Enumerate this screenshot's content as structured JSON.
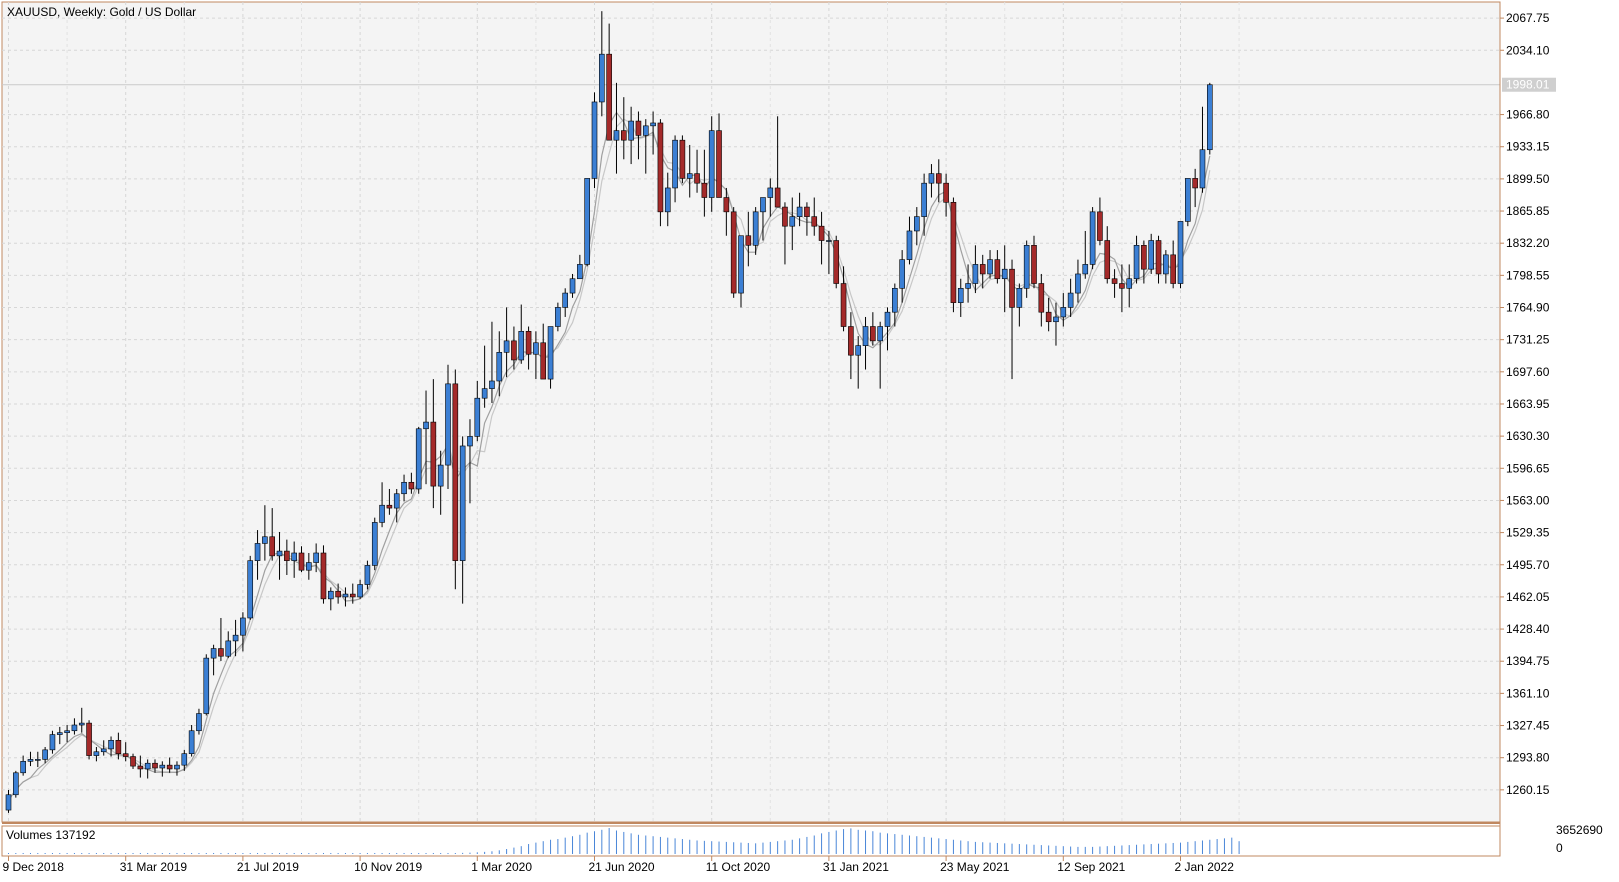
{
  "chart_data": {
    "type": "candlestick",
    "symbol_line": "XAUUSD, Weekly:  Gold / US Dollar",
    "current_price_label": "1998.01",
    "current_price": 1998.01,
    "ylim": [
      1226.5,
      2084.6
    ],
    "price_ticks": [
      "2067.75",
      "2034.10",
      "1966.80",
      "1933.15",
      "1899.50",
      "1865.85",
      "1832.20",
      "1798.55",
      "1764.90",
      "1731.25",
      "1697.60",
      "1663.95",
      "1630.30",
      "1596.65",
      "1563.00",
      "1529.35",
      "1495.70",
      "1462.05",
      "1428.40",
      "1394.75",
      "1361.10",
      "1327.45",
      "1293.80",
      "1260.15"
    ],
    "time_ticks": [
      {
        "label": "9 Dec 2018",
        "index": 0
      },
      {
        "label": "31 Mar 2019",
        "index": 16
      },
      {
        "label": "21 Jul 2019",
        "index": 32
      },
      {
        "label": "10 Nov 2019",
        "index": 48
      },
      {
        "label": "1 Mar 2020",
        "index": 64
      },
      {
        "label": "21 Jun 2020",
        "index": 80
      },
      {
        "label": "11 Oct 2020",
        "index": 96
      },
      {
        "label": "31 Jan 2021",
        "index": 112
      },
      {
        "label": "23 May 2021",
        "index": 128
      },
      {
        "label": "12 Sep 2021",
        "index": 144
      },
      {
        "label": "2 Jan 2022",
        "index": 160
      }
    ],
    "ohlc": [
      [
        1239,
        1260,
        1236,
        1255
      ],
      [
        1255,
        1280,
        1252,
        1278
      ],
      [
        1278,
        1296,
        1275,
        1290
      ],
      [
        1290,
        1300,
        1285,
        1292
      ],
      [
        1292,
        1300,
        1284,
        1292
      ],
      [
        1292,
        1305,
        1288,
        1302
      ],
      [
        1302,
        1322,
        1298,
        1318
      ],
      [
        1318,
        1326,
        1308,
        1320
      ],
      [
        1320,
        1328,
        1310,
        1322
      ],
      [
        1322,
        1335,
        1318,
        1328
      ],
      [
        1328,
        1346,
        1320,
        1330
      ],
      [
        1330,
        1333,
        1292,
        1296
      ],
      [
        1296,
        1305,
        1290,
        1300
      ],
      [
        1300,
        1312,
        1296,
        1303
      ],
      [
        1303,
        1316,
        1295,
        1312
      ],
      [
        1312,
        1320,
        1292,
        1298
      ],
      [
        1298,
        1310,
        1290,
        1295
      ],
      [
        1295,
        1298,
        1282,
        1285
      ],
      [
        1285,
        1296,
        1273,
        1282
      ],
      [
        1282,
        1292,
        1272,
        1288
      ],
      [
        1288,
        1292,
        1278,
        1283
      ],
      [
        1283,
        1290,
        1274,
        1286
      ],
      [
        1286,
        1294,
        1278,
        1282
      ],
      [
        1282,
        1290,
        1275,
        1286
      ],
      [
        1286,
        1302,
        1280,
        1298
      ],
      [
        1298,
        1328,
        1295,
        1322
      ],
      [
        1322,
        1345,
        1318,
        1340
      ],
      [
        1340,
        1402,
        1338,
        1398
      ],
      [
        1398,
        1412,
        1380,
        1408
      ],
      [
        1408,
        1440,
        1395,
        1400
      ],
      [
        1400,
        1426,
        1398,
        1416
      ],
      [
        1416,
        1438,
        1400,
        1422
      ],
      [
        1422,
        1446,
        1405,
        1440
      ],
      [
        1440,
        1505,
        1438,
        1500
      ],
      [
        1500,
        1532,
        1480,
        1518
      ],
      [
        1518,
        1558,
        1500,
        1525
      ],
      [
        1525,
        1555,
        1500,
        1505
      ],
      [
        1505,
        1530,
        1480,
        1510
      ],
      [
        1510,
        1522,
        1485,
        1500
      ],
      [
        1500,
        1520,
        1482,
        1508
      ],
      [
        1508,
        1515,
        1488,
        1490
      ],
      [
        1490,
        1508,
        1480,
        1498
      ],
      [
        1498,
        1518,
        1488,
        1508
      ],
      [
        1508,
        1516,
        1455,
        1460
      ],
      [
        1460,
        1472,
        1448,
        1468
      ],
      [
        1468,
        1476,
        1455,
        1462
      ],
      [
        1462,
        1472,
        1452,
        1465
      ],
      [
        1465,
        1476,
        1455,
        1462
      ],
      [
        1462,
        1480,
        1460,
        1475
      ],
      [
        1475,
        1500,
        1470,
        1495
      ],
      [
        1495,
        1545,
        1490,
        1540
      ],
      [
        1540,
        1582,
        1535,
        1558
      ],
      [
        1558,
        1575,
        1548,
        1555
      ],
      [
        1555,
        1575,
        1540,
        1570
      ],
      [
        1570,
        1590,
        1562,
        1582
      ],
      [
        1582,
        1592,
        1570,
        1575
      ],
      [
        1575,
        1640,
        1570,
        1638
      ],
      [
        1638,
        1678,
        1580,
        1645
      ],
      [
        1645,
        1690,
        1555,
        1578
      ],
      [
        1578,
        1615,
        1548,
        1600
      ],
      [
        1600,
        1705,
        1575,
        1685
      ],
      [
        1685,
        1700,
        1470,
        1500
      ],
      [
        1500,
        1630,
        1455,
        1620
      ],
      [
        1620,
        1648,
        1560,
        1630
      ],
      [
        1630,
        1688,
        1625,
        1670
      ],
      [
        1670,
        1725,
        1660,
        1680
      ],
      [
        1680,
        1750,
        1665,
        1688
      ],
      [
        1688,
        1740,
        1672,
        1718
      ],
      [
        1718,
        1765,
        1692,
        1730
      ],
      [
        1730,
        1745,
        1700,
        1710
      ],
      [
        1710,
        1768,
        1706,
        1740
      ],
      [
        1740,
        1745,
        1700,
        1716
      ],
      [
        1716,
        1740,
        1690,
        1728
      ],
      [
        1728,
        1748,
        1700,
        1690
      ],
      [
        1690,
        1740,
        1680,
        1745
      ],
      [
        1745,
        1770,
        1740,
        1765
      ],
      [
        1765,
        1785,
        1755,
        1780
      ],
      [
        1780,
        1800,
        1775,
        1795
      ],
      [
        1795,
        1820,
        1795,
        1810
      ],
      [
        1810,
        1900,
        1808,
        1900
      ],
      [
        1900,
        1990,
        1890,
        1980
      ],
      [
        1980,
        2075,
        1965,
        2030
      ],
      [
        2030,
        2062,
        1950,
        1940
      ],
      [
        1940,
        2000,
        1905,
        1950
      ],
      [
        1950,
        1985,
        1920,
        1940
      ],
      [
        1940,
        1975,
        1915,
        1960
      ],
      [
        1960,
        1970,
        1920,
        1945
      ],
      [
        1945,
        1962,
        1905,
        1955
      ],
      [
        1955,
        1970,
        1925,
        1958
      ],
      [
        1958,
        1962,
        1850,
        1865
      ],
      [
        1865,
        1906,
        1850,
        1890
      ],
      [
        1890,
        1945,
        1875,
        1940
      ],
      [
        1940,
        1945,
        1895,
        1900
      ],
      [
        1900,
        1935,
        1880,
        1905
      ],
      [
        1905,
        1930,
        1885,
        1895
      ],
      [
        1895,
        1930,
        1860,
        1880
      ],
      [
        1880,
        1965,
        1865,
        1950
      ],
      [
        1950,
        1968,
        1880,
        1880
      ],
      [
        1880,
        1890,
        1840,
        1865
      ],
      [
        1865,
        1870,
        1775,
        1780
      ],
      [
        1780,
        1840,
        1765,
        1840
      ],
      [
        1840,
        1865,
        1808,
        1830
      ],
      [
        1830,
        1870,
        1820,
        1865
      ],
      [
        1865,
        1880,
        1835,
        1880
      ],
      [
        1880,
        1900,
        1860,
        1890
      ],
      [
        1890,
        1965,
        1870,
        1870
      ],
      [
        1870,
        1875,
        1810,
        1850
      ],
      [
        1850,
        1880,
        1825,
        1860
      ],
      [
        1860,
        1885,
        1850,
        1870
      ],
      [
        1870,
        1875,
        1840,
        1860
      ],
      [
        1860,
        1880,
        1840,
        1850
      ],
      [
        1850,
        1865,
        1810,
        1835
      ],
      [
        1835,
        1845,
        1800,
        1835
      ],
      [
        1835,
        1840,
        1785,
        1790
      ],
      [
        1790,
        1808,
        1740,
        1745
      ],
      [
        1745,
        1760,
        1690,
        1715
      ],
      [
        1715,
        1735,
        1680,
        1725
      ],
      [
        1725,
        1755,
        1700,
        1745
      ],
      [
        1745,
        1760,
        1725,
        1730
      ],
      [
        1730,
        1750,
        1680,
        1745
      ],
      [
        1745,
        1765,
        1720,
        1760
      ],
      [
        1760,
        1790,
        1745,
        1785
      ],
      [
        1785,
        1825,
        1770,
        1815
      ],
      [
        1815,
        1860,
        1810,
        1845
      ],
      [
        1845,
        1870,
        1830,
        1860
      ],
      [
        1860,
        1905,
        1840,
        1895
      ],
      [
        1895,
        1915,
        1880,
        1905
      ],
      [
        1905,
        1920,
        1875,
        1895
      ],
      [
        1895,
        1905,
        1860,
        1875
      ],
      [
        1875,
        1880,
        1760,
        1770
      ],
      [
        1770,
        1795,
        1755,
        1785
      ],
      [
        1785,
        1810,
        1770,
        1790
      ],
      [
        1790,
        1830,
        1780,
        1810
      ],
      [
        1810,
        1820,
        1785,
        1800
      ],
      [
        1800,
        1825,
        1795,
        1815
      ],
      [
        1815,
        1825,
        1790,
        1795
      ],
      [
        1795,
        1830,
        1760,
        1805
      ],
      [
        1805,
        1815,
        1690,
        1765
      ],
      [
        1765,
        1790,
        1745,
        1785
      ],
      [
        1785,
        1835,
        1775,
        1830
      ],
      [
        1830,
        1840,
        1785,
        1790
      ],
      [
        1790,
        1800,
        1745,
        1760
      ],
      [
        1760,
        1775,
        1740,
        1750
      ],
      [
        1750,
        1770,
        1725,
        1755
      ],
      [
        1755,
        1780,
        1745,
        1765
      ],
      [
        1765,
        1795,
        1755,
        1780
      ],
      [
        1780,
        1815,
        1770,
        1800
      ],
      [
        1800,
        1845,
        1795,
        1810
      ],
      [
        1810,
        1870,
        1805,
        1865
      ],
      [
        1865,
        1880,
        1830,
        1835
      ],
      [
        1835,
        1850,
        1790,
        1795
      ],
      [
        1795,
        1805,
        1775,
        1790
      ],
      [
        1790,
        1810,
        1760,
        1785
      ],
      [
        1785,
        1810,
        1765,
        1795
      ],
      [
        1795,
        1840,
        1790,
        1830
      ],
      [
        1830,
        1835,
        1790,
        1805
      ],
      [
        1805,
        1842,
        1800,
        1835
      ],
      [
        1835,
        1840,
        1790,
        1800
      ],
      [
        1800,
        1825,
        1790,
        1820
      ],
      [
        1820,
        1835,
        1785,
        1790
      ],
      [
        1790,
        1850,
        1785,
        1855
      ],
      [
        1855,
        1880,
        1850,
        1900
      ],
      [
        1900,
        1910,
        1870,
        1890
      ],
      [
        1890,
        1975,
        1885,
        1930
      ],
      [
        1930,
        2000,
        1925,
        1998
      ]
    ],
    "ma_fast_color": "#a0a0a0",
    "ma_slow_color": "#c8c8c8",
    "bull_color": "#3b7fd4",
    "bear_color": "#a42a2a",
    "volume_label": "Volumes 137192",
    "volume_axis_max": "3652690",
    "volume_axis_min": "0",
    "volume_max": 3652690,
    "volumes": [
      40000,
      42000,
      38000,
      41000,
      39000,
      43000,
      45000,
      42000,
      40000,
      44000,
      46000,
      43000,
      41000,
      40000,
      42000,
      39000,
      38000,
      40000,
      41000,
      39000,
      42000,
      40000,
      38000,
      41000,
      43000,
      45000,
      47000,
      50000,
      48000,
      46000,
      44000,
      43000,
      47000,
      52000,
      50000,
      49000,
      48000,
      46000,
      45000,
      44000,
      43000,
      42000,
      44000,
      45000,
      43000,
      41000,
      40000,
      42000,
      44000,
      46000,
      48000,
      50000,
      47000,
      45000,
      46000,
      47000,
      52000,
      60000,
      70000,
      62000,
      80000,
      120000,
      160000,
      190000,
      240000,
      300000,
      380000,
      520000,
      700000,
      900000,
      1100000,
      1400000,
      1600000,
      1800000,
      2000000,
      2100000,
      2300000,
      2500000,
      2700000,
      3000000,
      3200000,
      3400000,
      3650000,
      3300000,
      3100000,
      2900000,
      2700000,
      2600000,
      2500000,
      2400000,
      2300000,
      2200000,
      2100000,
      2000000,
      1900000,
      1850000,
      1800000,
      1750000,
      1700000,
      1650000,
      1600000,
      1550000,
      1500000,
      1600000,
      1700000,
      1800000,
      1900000,
      2000000,
      2200000,
      2400000,
      2600000,
      2900000,
      3100000,
      3300000,
      3500000,
      3600000,
      3400000,
      3300000,
      3200000,
      3000000,
      2900000,
      2800000,
      2700000,
      2600000,
      2500000,
      2400000,
      2300000,
      2200000,
      2100000,
      2000000,
      1900000,
      1800000,
      1700000,
      1650000,
      1600000,
      1550000,
      1500000,
      1450000,
      1400000,
      1350000,
      1300000,
      1250000,
      1200000,
      1150000,
      1100000,
      1050000,
      1000000,
      1000000,
      1000000,
      1050000,
      1100000,
      1150000,
      1200000,
      1250000,
      1300000,
      1350000,
      1400000,
      1450000,
      1500000,
      1550000,
      1600000,
      1700000,
      1800000,
      1900000,
      2000000,
      2100000,
      2200000,
      2300000,
      1800000
    ]
  }
}
